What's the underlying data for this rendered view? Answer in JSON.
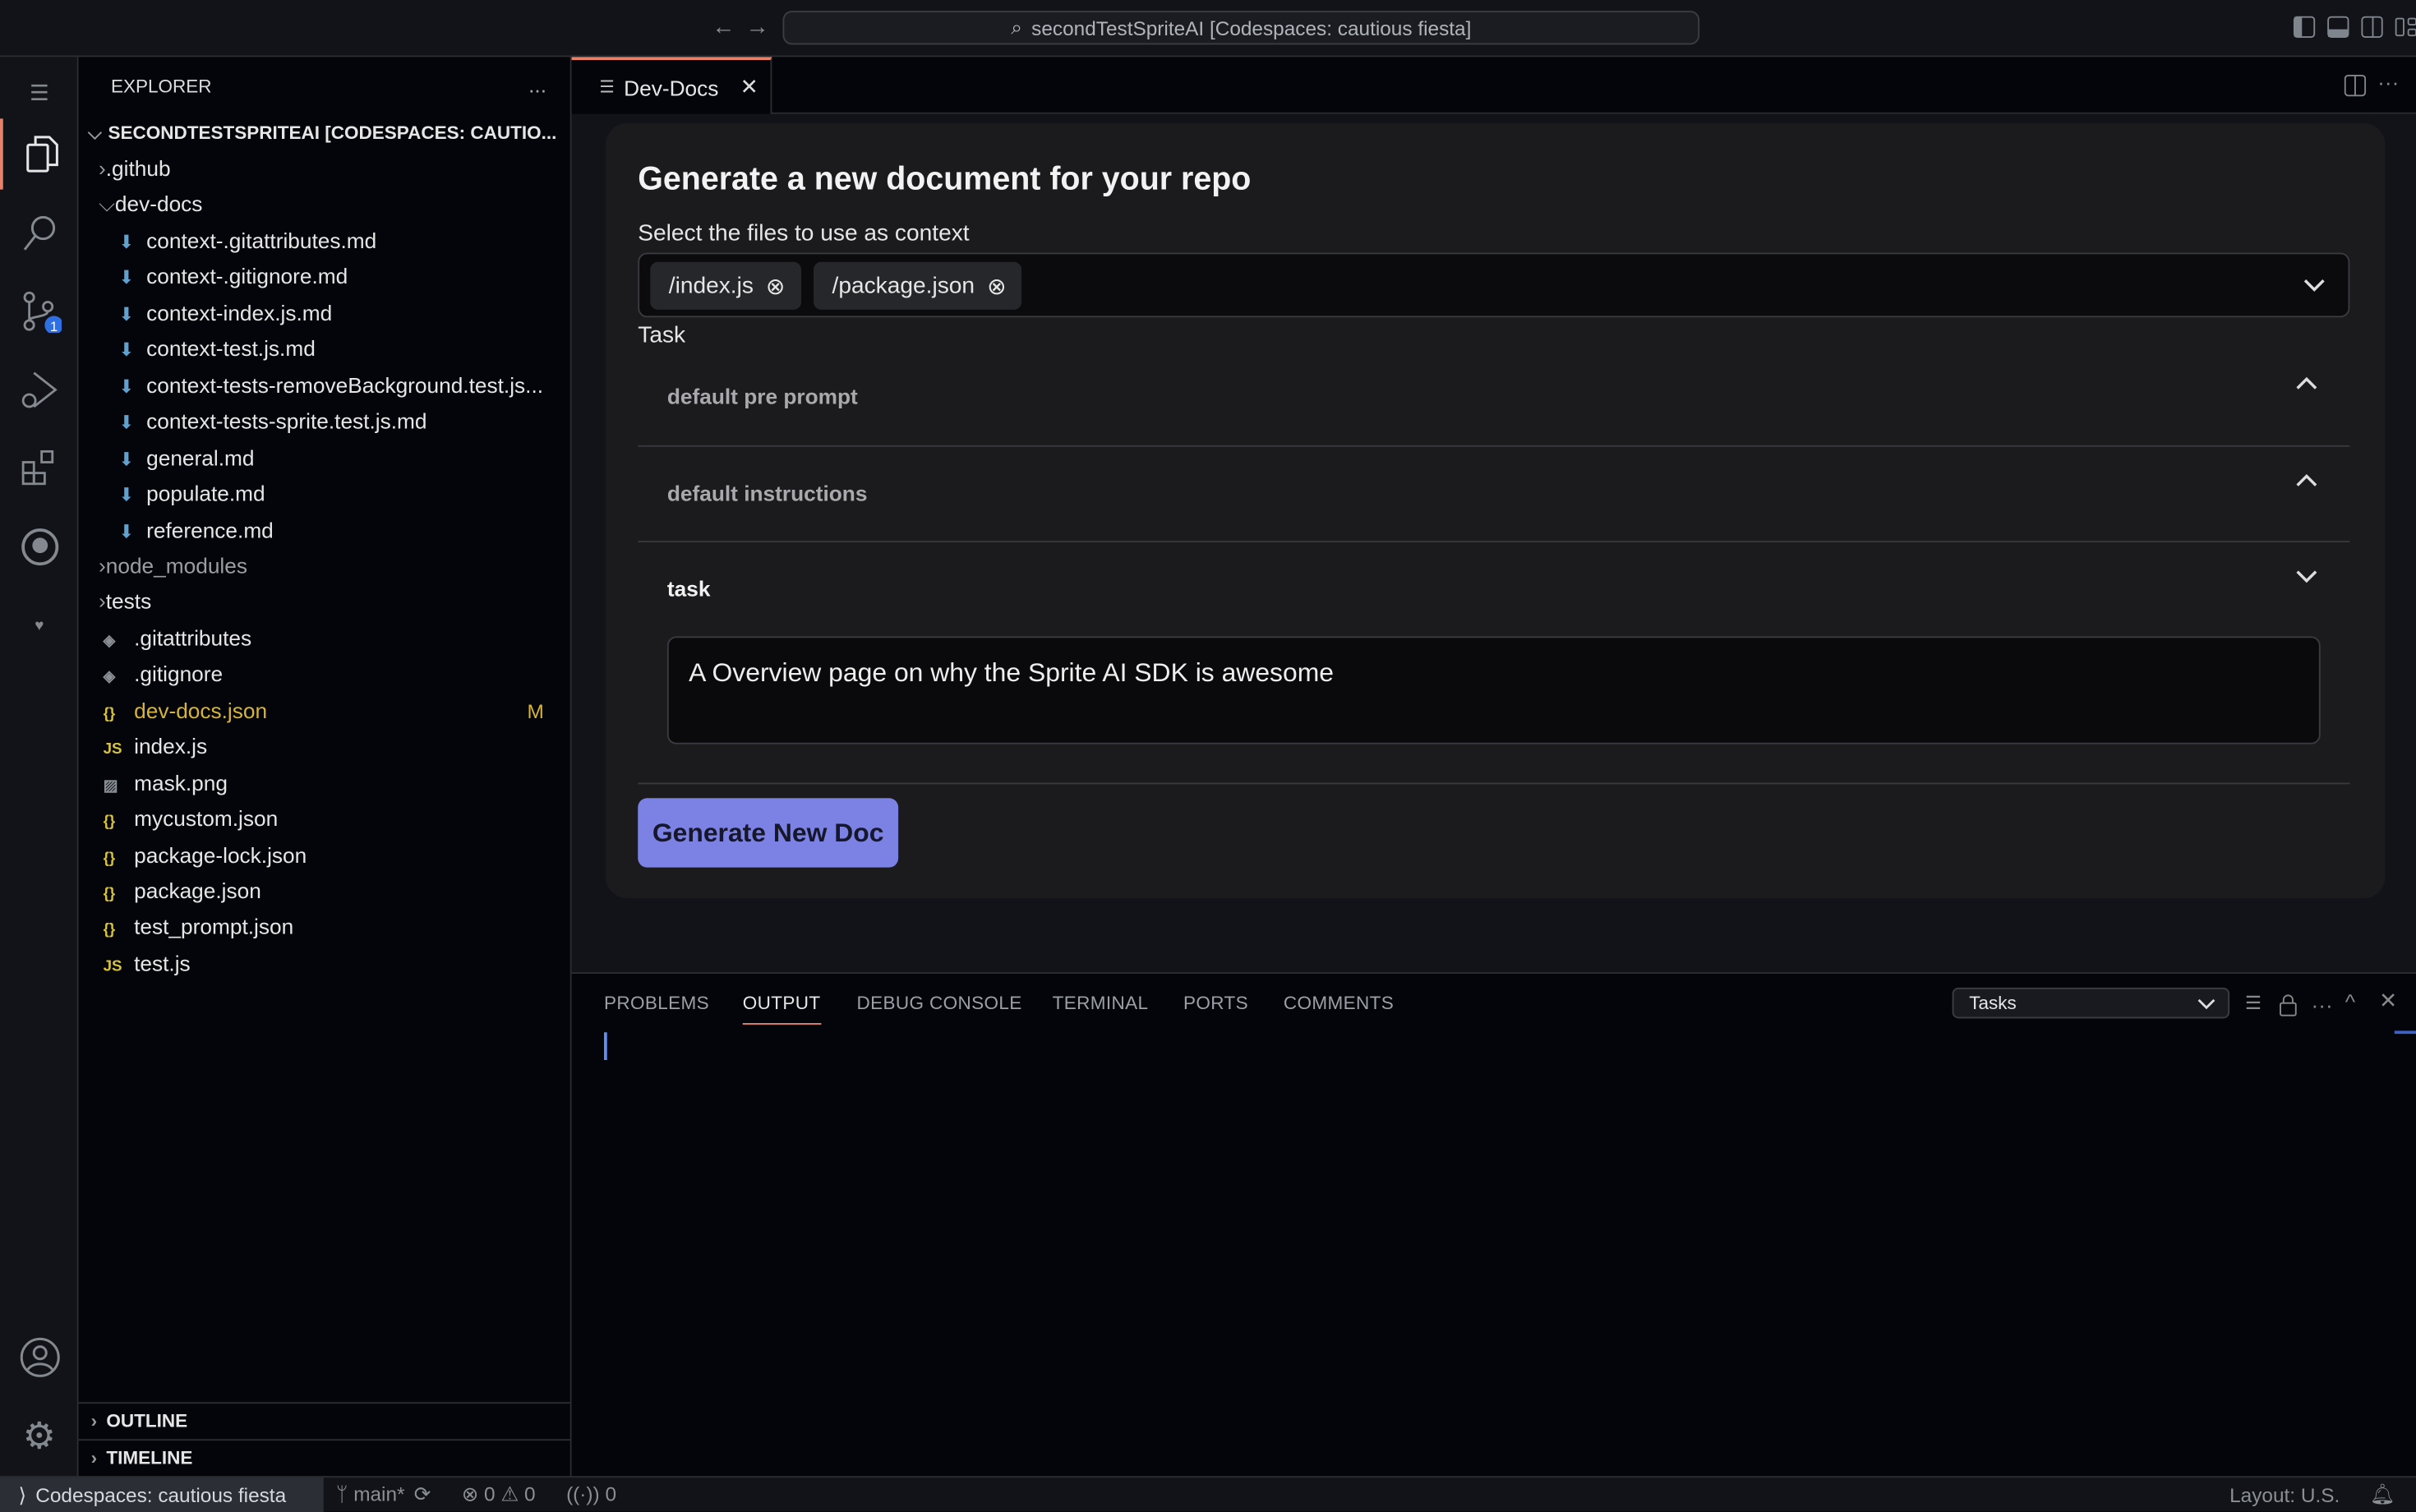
{
  "titlebar": {
    "command_center": "secondTestSpriteAI [Codespaces: cautious fiesta]"
  },
  "activity": {
    "scm_badge": "1"
  },
  "sidebar": {
    "title": "EXPLORER",
    "more": "...",
    "root": "SECONDTESTSPRITEAI [CODESPACES: CAUTIO...",
    "items": [
      {
        "label": ".github",
        "type": "folder",
        "open": false,
        "indent": 0
      },
      {
        "label": "dev-docs",
        "type": "folder",
        "open": true,
        "indent": 0
      },
      {
        "label": "context-.gitattributes.md",
        "type": "md",
        "indent": 1
      },
      {
        "label": "context-.gitignore.md",
        "type": "md",
        "indent": 1
      },
      {
        "label": "context-index.js.md",
        "type": "md",
        "indent": 1
      },
      {
        "label": "context-test.js.md",
        "type": "md",
        "indent": 1
      },
      {
        "label": "context-tests-removeBackground.test.js...",
        "type": "md",
        "indent": 1
      },
      {
        "label": "context-tests-sprite.test.js.md",
        "type": "md",
        "indent": 1
      },
      {
        "label": "general.md",
        "type": "md",
        "indent": 1
      },
      {
        "label": "populate.md",
        "type": "md",
        "indent": 1
      },
      {
        "label": "reference.md",
        "type": "md",
        "indent": 1
      },
      {
        "label": "node_modules",
        "type": "folder",
        "open": false,
        "indent": 0,
        "dim": true
      },
      {
        "label": "tests",
        "type": "folder",
        "open": false,
        "indent": 0
      },
      {
        "label": ".gitattributes",
        "type": "git",
        "indent": 0
      },
      {
        "label": ".gitignore",
        "type": "git",
        "indent": 0
      },
      {
        "label": "dev-docs.json",
        "type": "json",
        "indent": 0,
        "modified": "M"
      },
      {
        "label": "index.js",
        "type": "js",
        "indent": 0
      },
      {
        "label": "mask.png",
        "type": "img",
        "indent": 0
      },
      {
        "label": "mycustom.json",
        "type": "json",
        "indent": 0
      },
      {
        "label": "package-lock.json",
        "type": "json",
        "indent": 0
      },
      {
        "label": "package.json",
        "type": "json",
        "indent": 0
      },
      {
        "label": "test_prompt.json",
        "type": "json",
        "indent": 0
      },
      {
        "label": "test.js",
        "type": "js",
        "indent": 0
      }
    ],
    "outline": "OUTLINE",
    "timeline": "TIMELINE"
  },
  "editor": {
    "tab": "Dev-Docs",
    "heading": "Generate a new document for your repo",
    "files_label": "Select the files to use as context",
    "files": [
      "/index.js",
      "/package.json"
    ],
    "task_label": "Task",
    "sections": [
      {
        "label": "default pre prompt",
        "expanded": false
      },
      {
        "label": "default instructions",
        "expanded": false
      },
      {
        "label": "task",
        "expanded": true
      }
    ],
    "task_value": "A Overview page on why the Sprite AI SDK is awesome",
    "generate_button": "Generate New Doc"
  },
  "panel": {
    "tabs": [
      "PROBLEMS",
      "OUTPUT",
      "DEBUG CONSOLE",
      "TERMINAL",
      "PORTS",
      "COMMENTS"
    ],
    "active_tab": "OUTPUT",
    "channel": "Tasks"
  },
  "status": {
    "remote": "Codespaces: cautious fiesta",
    "branch": "main*",
    "errors": "0",
    "warnings": "0",
    "ports": "0",
    "layout": "Layout: U.S."
  },
  "colors": {
    "accent": "#e8816a",
    "button": "#7b82e3",
    "modified": "#d6b33b",
    "badge": "#2f6fe4"
  }
}
